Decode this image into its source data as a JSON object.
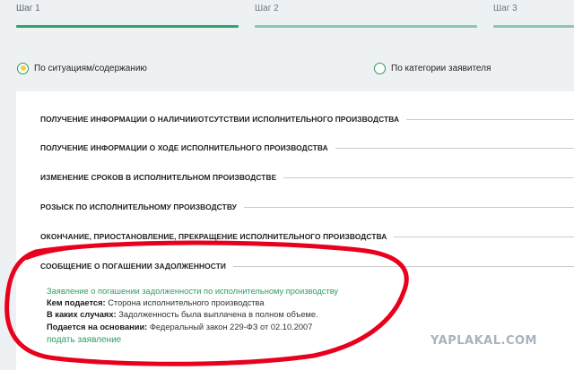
{
  "steps": [
    {
      "label": "Шаг 1",
      "state": "active"
    },
    {
      "label": "Шаг 2",
      "state": "inactive"
    },
    {
      "label": "Шаг 3",
      "state": "inactive"
    }
  ],
  "filters": {
    "by_situation": {
      "label": "По ситуациям/содержанию",
      "selected": true
    },
    "by_applicant": {
      "label": "По категории заявителя",
      "selected": false
    }
  },
  "categories": [
    "ПОЛУЧЕНИЕ ИНФОРМАЦИИ О НАЛИЧИИ/ОТСУТСТВИИ ИСПОЛНИТЕЛЬНОГО ПРОИЗВОДСТВА",
    "ПОЛУЧЕНИЕ ИНФОРМАЦИИ О ХОДЕ ИСПОЛНИТЕЛЬНОГО ПРОИЗВОДСТВА",
    "ИЗМЕНЕНИЕ СРОКОВ В ИСПОЛНИТЕЛЬНОМ ПРОИЗВОДСТВЕ",
    "РОЗЫСК ПО ИСПОЛНИТЕЛЬНОМУ ПРОИЗВОДСТВУ",
    "ОКОНЧАНИЕ, ПРИОСТАНОВЛЕНИЕ, ПРЕКРАЩЕНИЕ ИСПОЛНИТЕЛЬНОГО ПРОИЗВОДСТВА",
    "СООБЩЕНИЕ О ПОГАШЕНИИ ЗАДОЛЖЕННОСТИ"
  ],
  "detail": {
    "title_link": "Заявление о погашении задолженности по исполнительному производству",
    "who_label": "Кем подается:",
    "who_value": "Сторона исполнительного производства",
    "when_label": "В каких случаях:",
    "when_value": "Задолженность была выплачена в полном объеме.",
    "basis_label": "Подается на основании:",
    "basis_value": "Федеральный закон 229-ФЗ от 02.10.2007",
    "submit_link": "подать заявление"
  },
  "watermark": "YAPLAKAL.COM",
  "colors": {
    "accent_green": "#2fa36a",
    "inactive_step": "#8bc7ad",
    "radio_dot": "#f0d13e",
    "annotation_red": "#e8001c"
  }
}
